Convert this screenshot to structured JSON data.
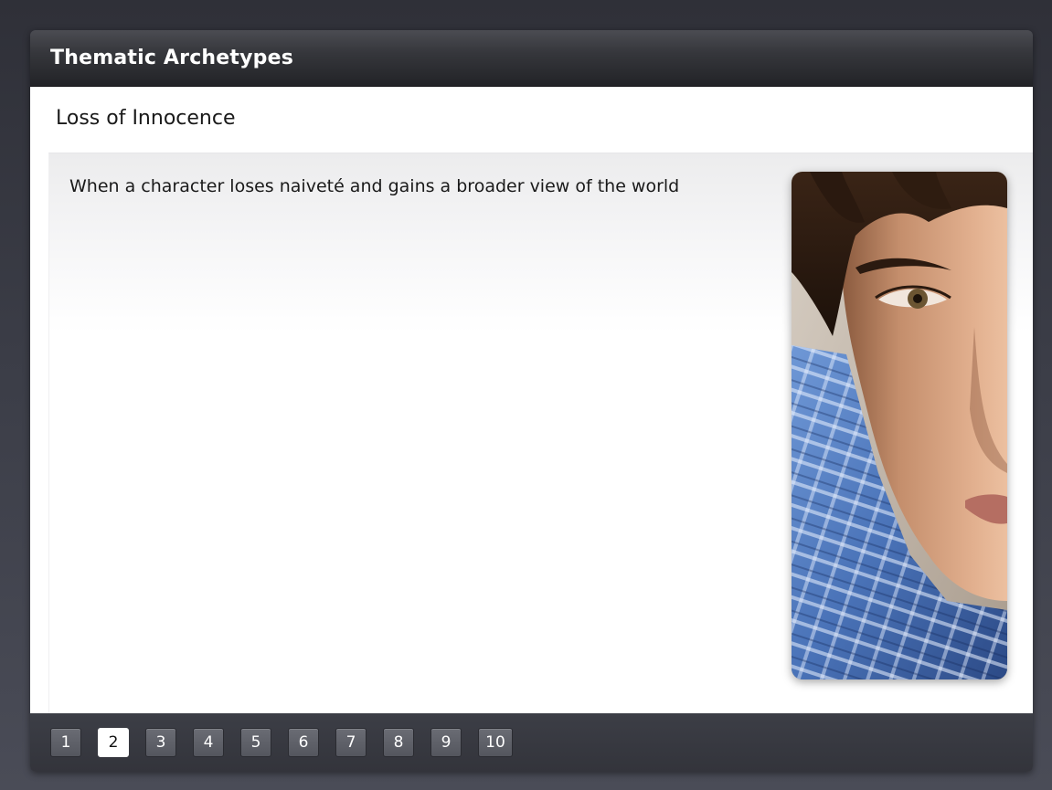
{
  "window": {
    "title": "Thematic Archetypes"
  },
  "slide": {
    "heading": "Loss of Innocence",
    "body": "When a character loses naiveté and gains a broader view of the world",
    "image_alt": "close-up of a young man's face in a blue plaid shirt"
  },
  "pagination": {
    "pages": [
      "1",
      "2",
      "3",
      "4",
      "5",
      "6",
      "7",
      "8",
      "9",
      "10"
    ],
    "current": "2"
  },
  "colors": {
    "titlebar": "#2b2c31",
    "footer": "#36373e",
    "active_page_bg": "#ffffff",
    "page_bg": "#5c5e66"
  }
}
